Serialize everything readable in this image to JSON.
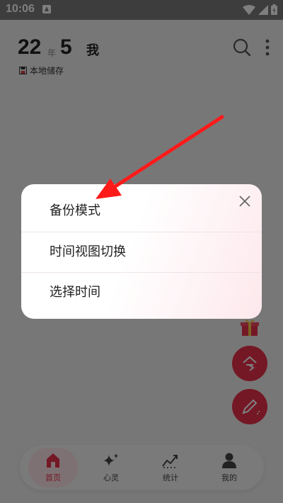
{
  "status_bar": {
    "time": "10:06"
  },
  "header": {
    "year": "22",
    "year_label": "年",
    "month": "5",
    "user_label": "我",
    "storage_label": "本地储存"
  },
  "popup_menu": {
    "items": [
      {
        "label": "备份模式"
      },
      {
        "label": "时间视图切换"
      },
      {
        "label": "选择时间"
      }
    ]
  },
  "bottom_nav": {
    "items": [
      {
        "label": "首页",
        "icon": "home-icon",
        "active": true
      },
      {
        "label": "心灵",
        "icon": "sparkle-icon",
        "active": false
      },
      {
        "label": "统计",
        "icon": "trend-icon",
        "active": false
      },
      {
        "label": "我的",
        "icon": "person-icon",
        "active": false
      }
    ]
  },
  "fab": {
    "today_label": "今"
  },
  "colors": {
    "accent": "#e8304a",
    "arrow": "#ff1a1a",
    "overlay": "rgba(0,0,0,0.5)"
  }
}
